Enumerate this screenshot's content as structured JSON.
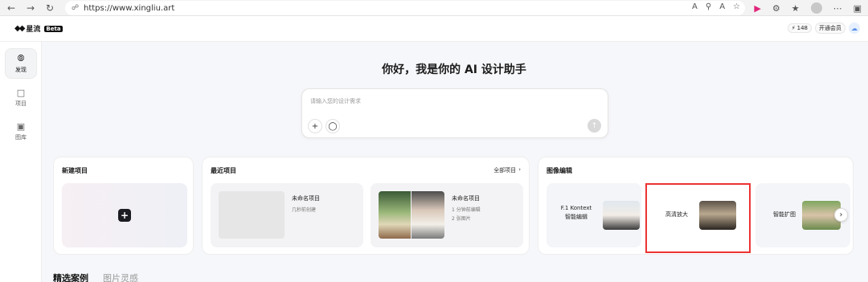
{
  "browser": {
    "url": "https://www.xingliu.art",
    "toolbar_icons": [
      "read-aloud-icon",
      "zoom-icon",
      "font-icon",
      "favorite-icon",
      "extension-icon",
      "puzzle-icon",
      "favorites-list-icon",
      "profile-icon",
      "more-icon",
      "sidebar-icon"
    ]
  },
  "header": {
    "logo_text": "星流",
    "beta_badge": "Beta",
    "credits": "148",
    "member_button": "开通会员"
  },
  "sidebar": {
    "items": [
      {
        "label": "发现",
        "icon": "planet-icon",
        "active": true
      },
      {
        "label": "项目",
        "icon": "folder-icon",
        "active": false
      },
      {
        "label": "图库",
        "icon": "image-icon",
        "active": false
      }
    ]
  },
  "main": {
    "greeting": "你好，我是你的 AI 设计助手",
    "prompt": {
      "placeholder": "请输入您的设计需求"
    },
    "new_project": {
      "title": "新建项目"
    },
    "recent_projects": {
      "title": "最近项目",
      "view_all": "全部项目",
      "items": [
        {
          "name": "未命名项目",
          "meta1": "几秒前创建",
          "meta2": ""
        },
        {
          "name": "未命名项目",
          "meta1": "1 分钟前编辑",
          "meta2": "2 张图片"
        }
      ]
    },
    "image_edit": {
      "title": "图像编辑",
      "items": [
        {
          "label_line1": "F.1 Kontext",
          "label_line2": "智能编辑"
        },
        {
          "label_line1": "高清放大",
          "label_line2": ""
        },
        {
          "label_line1": "智能扩图",
          "label_line2": ""
        }
      ]
    },
    "tabs": [
      "精选案例",
      "图片灵感"
    ]
  },
  "colors": {
    "highlight": "#e33333",
    "accent_dark": "#1b1b22"
  }
}
